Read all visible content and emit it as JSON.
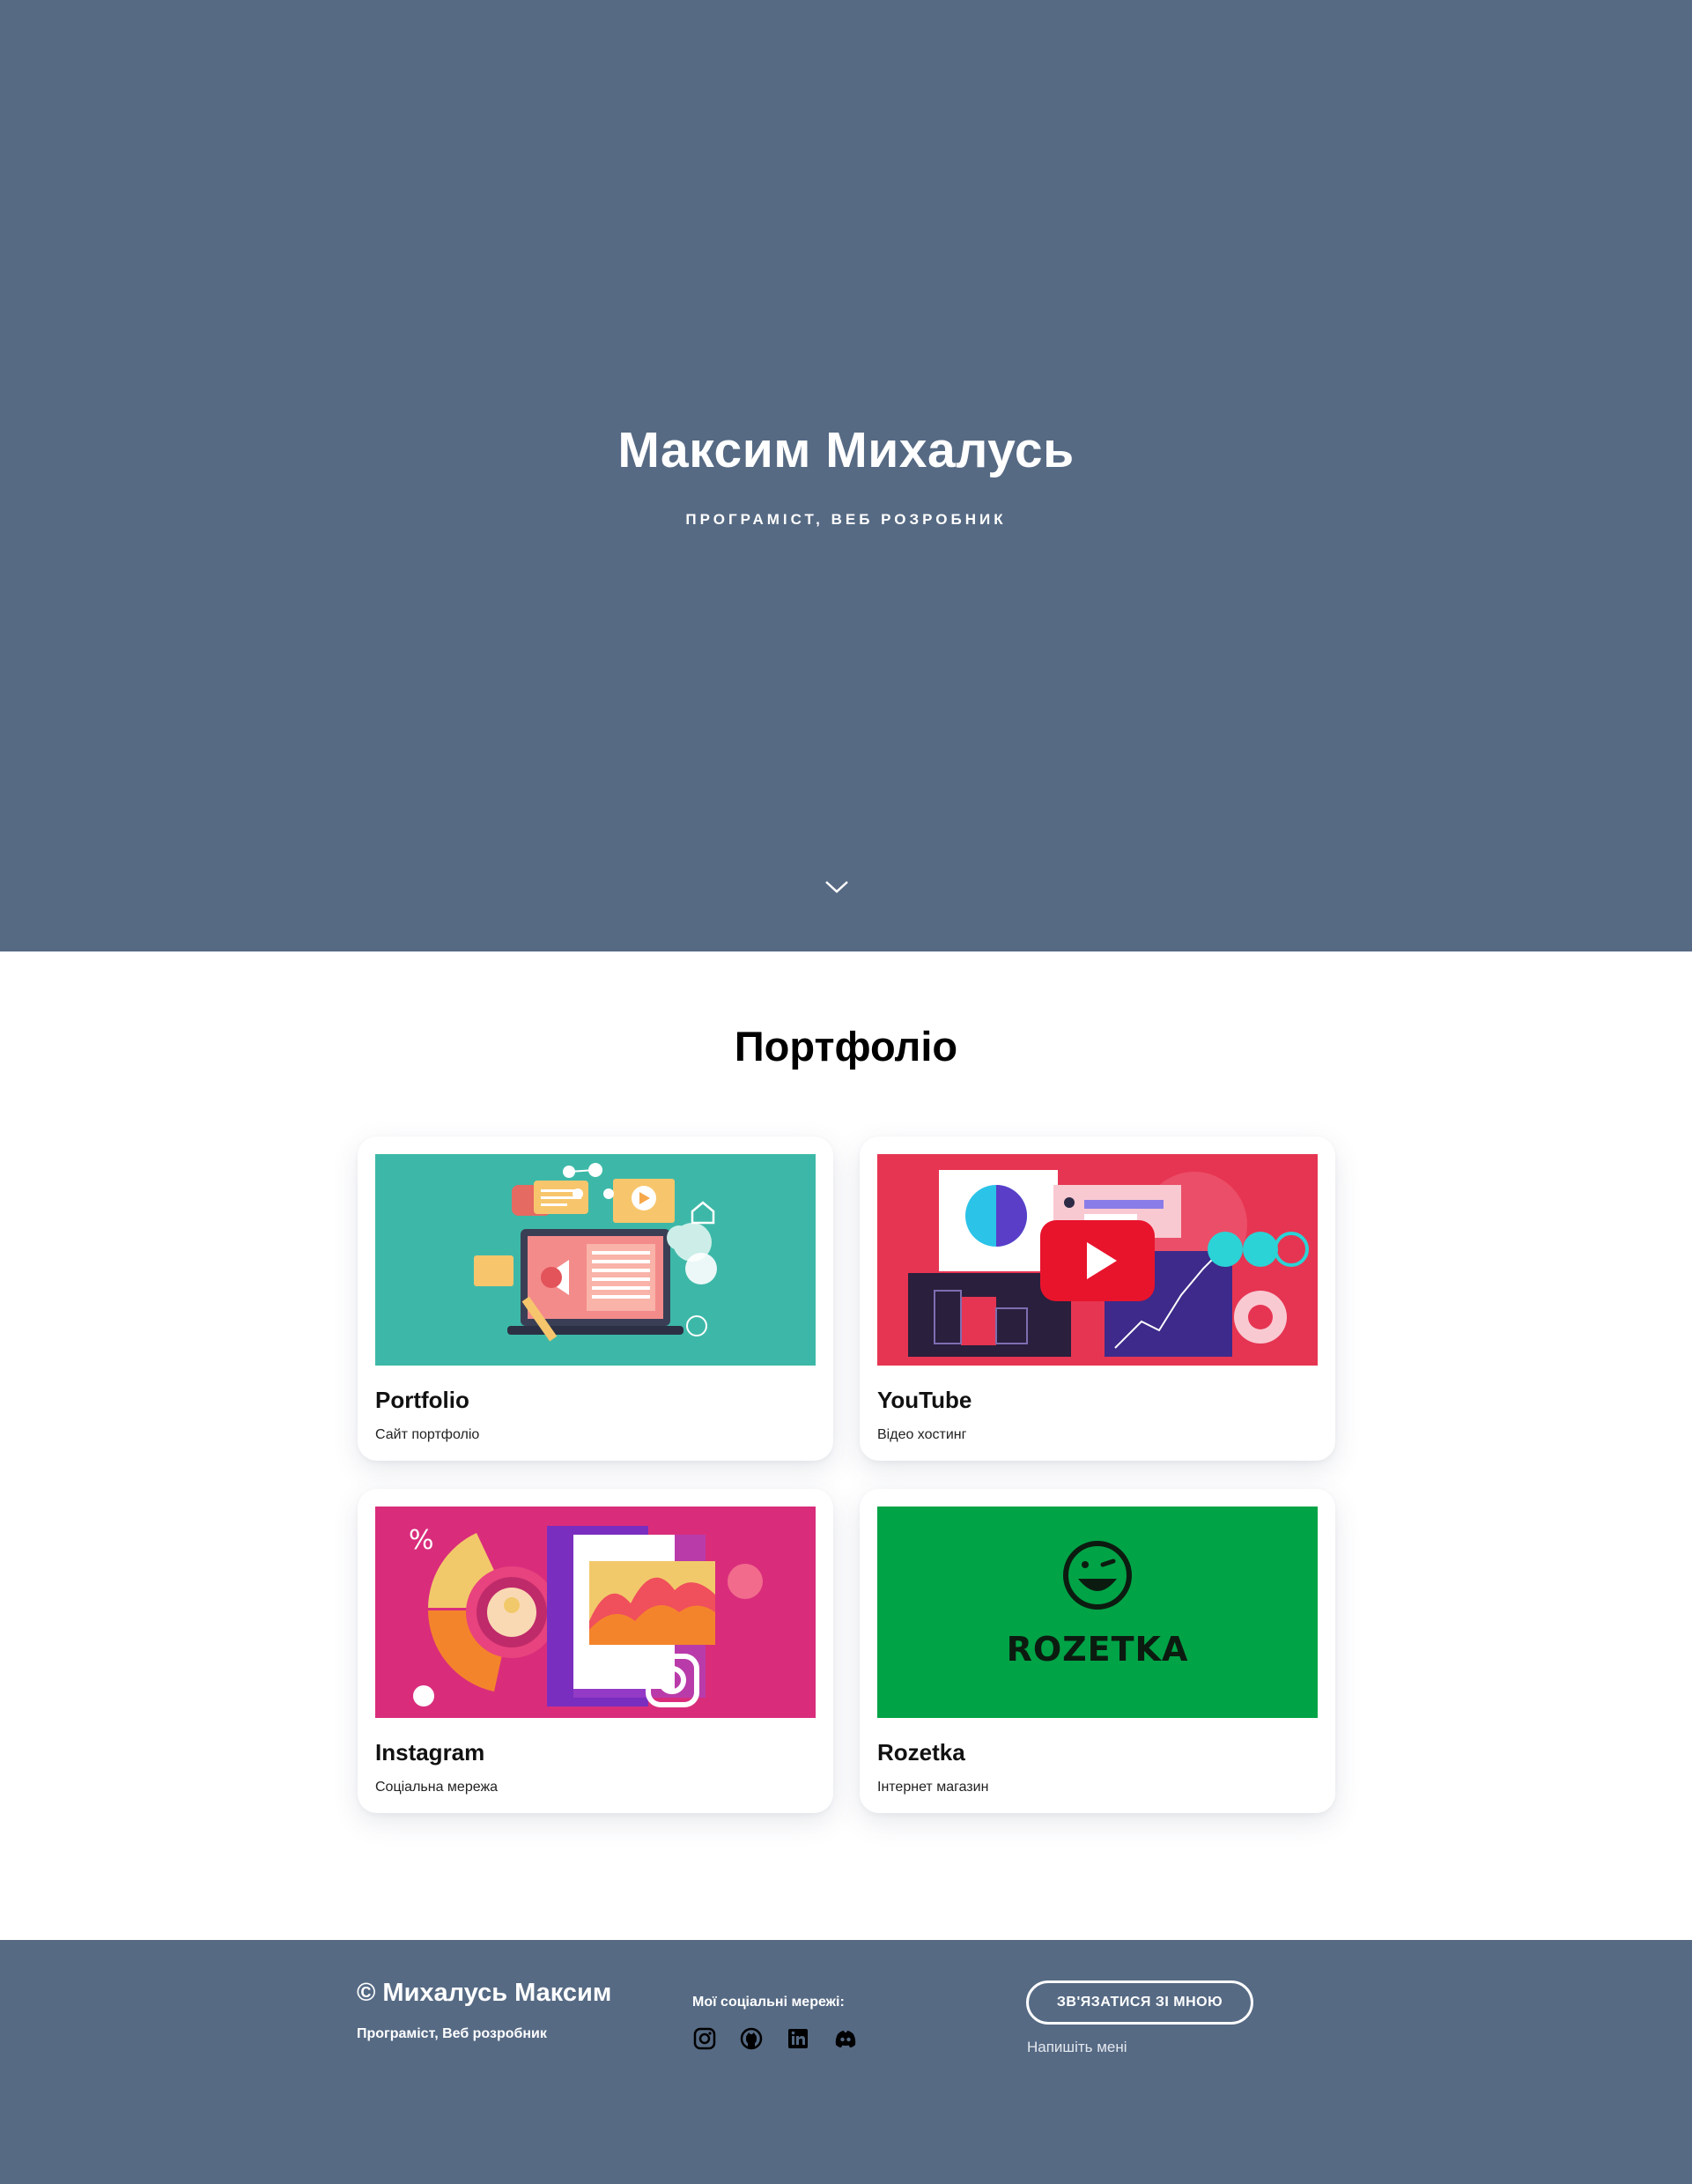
{
  "hero": {
    "title": "Максим Михалусь",
    "subtitle": "програміст, веб розробник",
    "scroll_icon": "chevron-down-icon",
    "background": "#566a84"
  },
  "portfolio": {
    "title": "Портфоліо",
    "cards": [
      {
        "title": "Portfolio",
        "description": "Сайт портфоліо",
        "image_bg": "#3db8a8"
      },
      {
        "title": "YouTube",
        "description": "Відео хостинг",
        "image_bg": "#e63552"
      },
      {
        "title": "Instagram",
        "description": "Соціальна мережа",
        "image_bg": "#d92d7c"
      },
      {
        "title": "Rozetka",
        "description": "Інтернет магазин",
        "image_bg": "#00a346",
        "logo_text": "ROZETKA"
      }
    ]
  },
  "footer": {
    "copyright": "© Михалусь Максим",
    "role": "Програміст, Веб розробник",
    "social_label": "Мої соціальні мережі:",
    "social_icons": [
      "instagram-icon",
      "github-icon",
      "linkedin-icon",
      "discord-icon"
    ],
    "contact_button": "Зв'язатися зі мною",
    "write_me": "Напишіть мені",
    "background": "#566a84"
  }
}
